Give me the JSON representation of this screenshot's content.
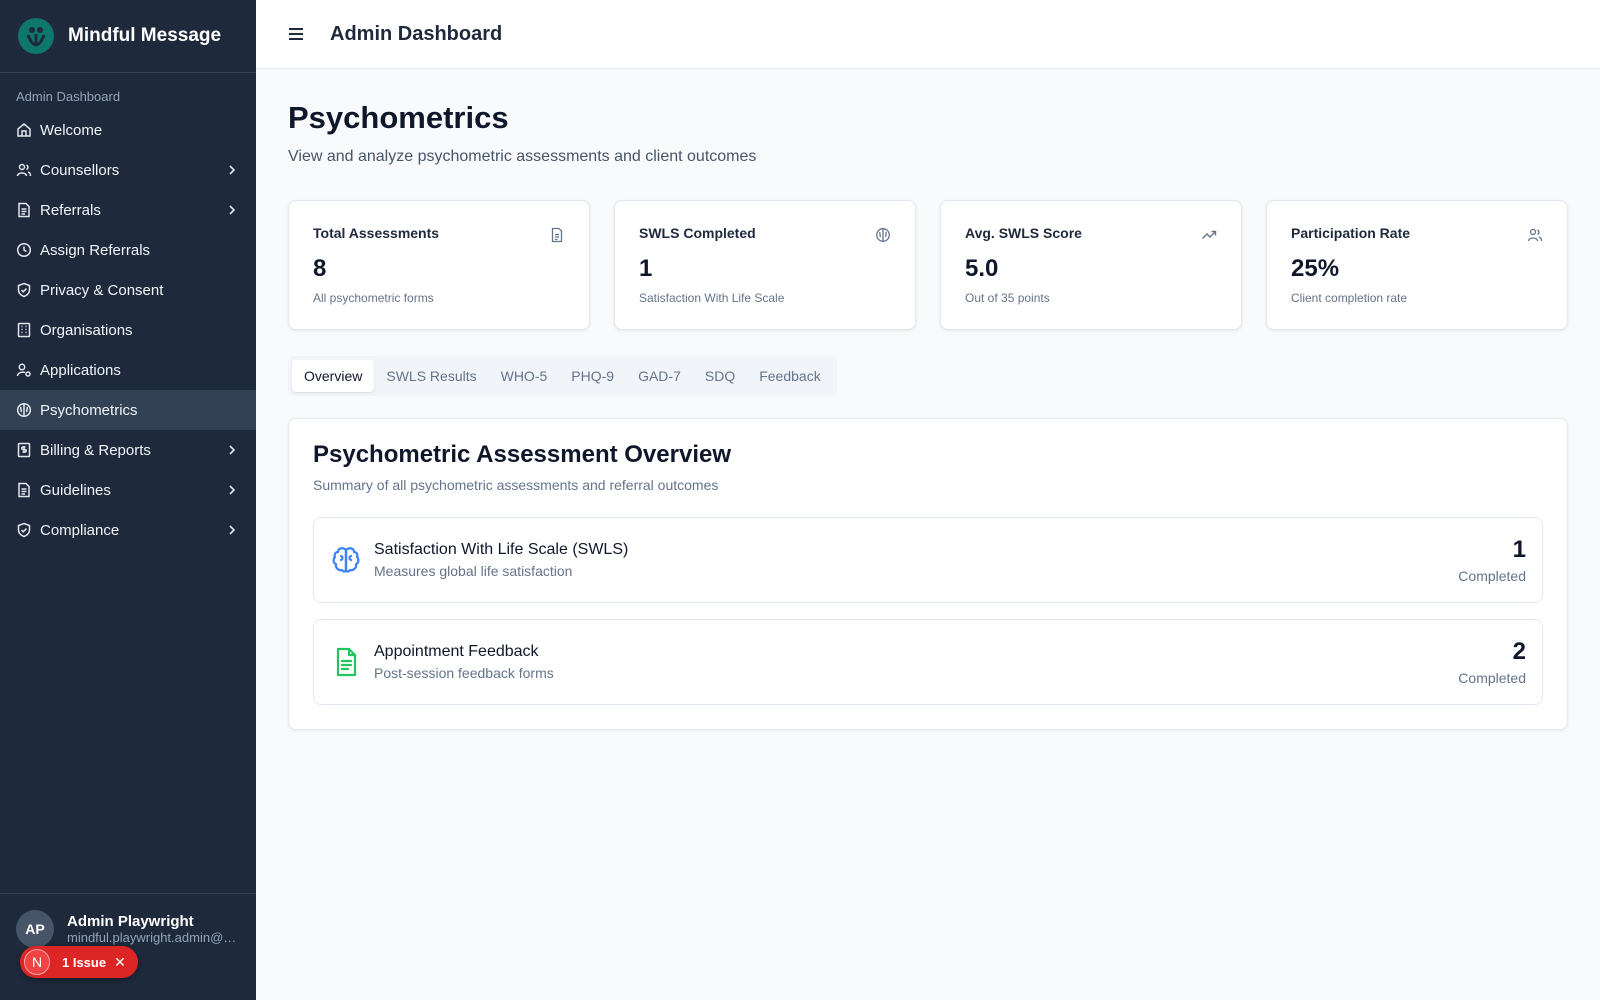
{
  "brand": {
    "name": "Mindful Message"
  },
  "sidebar": {
    "section_label": "Admin Dashboard",
    "items": [
      {
        "label": "Welcome",
        "icon": "home-icon",
        "has_chevron": false
      },
      {
        "label": "Counsellors",
        "icon": "users-icon",
        "has_chevron": true
      },
      {
        "label": "Referrals",
        "icon": "document-icon",
        "has_chevron": true
      },
      {
        "label": "Assign Referrals",
        "icon": "clock-icon",
        "has_chevron": false
      },
      {
        "label": "Privacy & Consent",
        "icon": "shield-icon",
        "has_chevron": false
      },
      {
        "label": "Organisations",
        "icon": "building-icon",
        "has_chevron": false
      },
      {
        "label": "Applications",
        "icon": "user-cog-icon",
        "has_chevron": false
      },
      {
        "label": "Psychometrics",
        "icon": "brain-icon",
        "has_chevron": false,
        "active": true
      },
      {
        "label": "Billing & Reports",
        "icon": "receipt-icon",
        "has_chevron": true
      },
      {
        "label": "Guidelines",
        "icon": "document-icon",
        "has_chevron": true
      },
      {
        "label": "Compliance",
        "icon": "shield-check-icon",
        "has_chevron": true
      }
    ],
    "user": {
      "initials": "AP",
      "name": "Admin Playwright",
      "email": "mindful.playwright.admin@f..."
    },
    "issue_badge": {
      "letter": "N",
      "label": "1 Issue",
      "close": "✕"
    }
  },
  "header": {
    "title": "Admin Dashboard",
    "menu_icon": "hamburger-icon"
  },
  "page": {
    "title": "Psychometrics",
    "subtitle": "View and analyze psychometric assessments and client outcomes"
  },
  "stats": [
    {
      "label": "Total Assessments",
      "value": "8",
      "hint": "All psychometric forms",
      "icon": "file-icon"
    },
    {
      "label": "SWLS Completed",
      "value": "1",
      "hint": "Satisfaction With Life Scale",
      "icon": "brain-icon"
    },
    {
      "label": "Avg. SWLS Score",
      "value": "5.0",
      "hint": "Out of 35 points",
      "icon": "trending-up-icon"
    },
    {
      "label": "Participation Rate",
      "value": "25%",
      "hint": "Client completion rate",
      "icon": "users-icon"
    }
  ],
  "tabs": [
    {
      "label": "Overview",
      "active": true
    },
    {
      "label": "SWLS Results"
    },
    {
      "label": "WHO-5"
    },
    {
      "label": "PHQ-9"
    },
    {
      "label": "GAD-7"
    },
    {
      "label": "SDQ"
    },
    {
      "label": "Feedback"
    }
  ],
  "overview": {
    "title": "Psychometric Assessment Overview",
    "subtitle": "Summary of all psychometric assessments and referral outcomes",
    "items": [
      {
        "name": "Satisfaction With Life Scale (SWLS)",
        "desc": "Measures global life satisfaction",
        "count": "1",
        "unit": "Completed",
        "icon": "brain-icon",
        "color": "#3b82f6"
      },
      {
        "name": "Appointment Feedback",
        "desc": "Post-session feedback forms",
        "count": "2",
        "unit": "Completed",
        "icon": "file-text-icon",
        "color": "#22c55e"
      }
    ]
  }
}
